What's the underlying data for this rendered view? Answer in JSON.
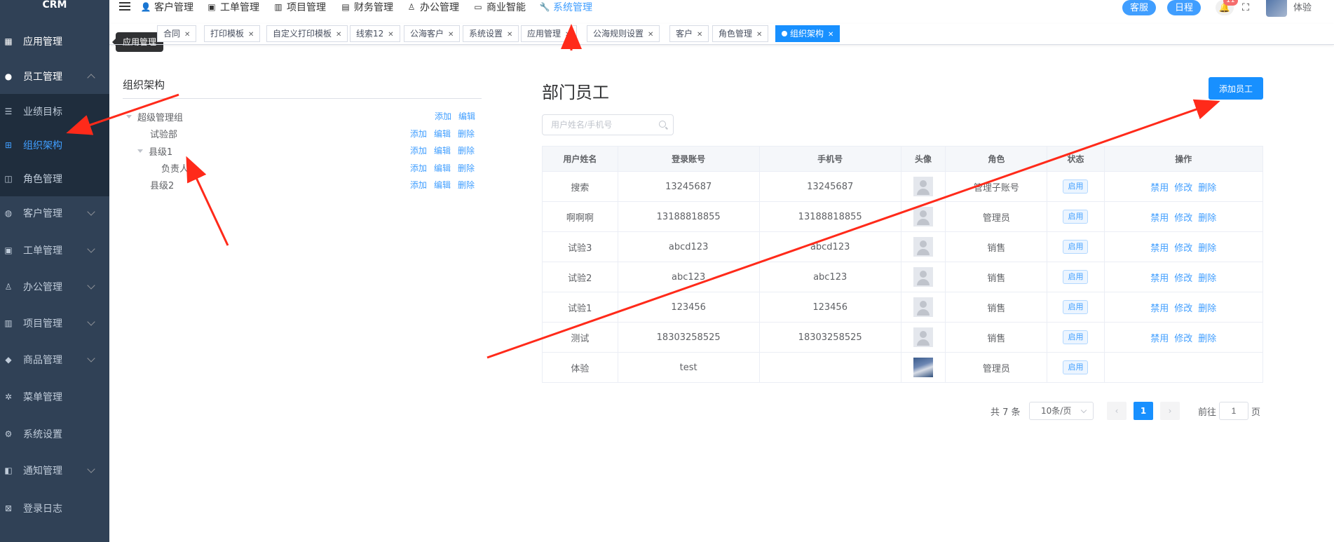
{
  "app": {
    "logo": "CRM"
  },
  "sidebar": {
    "items": [
      {
        "label": "应用管理",
        "icon": "grid-icon"
      },
      {
        "label": "员工管理",
        "icon": "user-icon"
      },
      {
        "label": "业绩目标",
        "icon": "list-icon"
      },
      {
        "label": "组织架构",
        "icon": "org-icon"
      },
      {
        "label": "角色管理",
        "icon": "role-icon"
      },
      {
        "label": "客户管理",
        "icon": "customer-icon"
      },
      {
        "label": "工单管理",
        "icon": "clipboard-icon"
      },
      {
        "label": "办公管理",
        "icon": "office-icon"
      },
      {
        "label": "项目管理",
        "icon": "project-icon"
      },
      {
        "label": "商品管理",
        "icon": "product-icon"
      },
      {
        "label": "菜单管理",
        "icon": "menu-gear-icon"
      },
      {
        "label": "系统设置",
        "icon": "settings-icon"
      },
      {
        "label": "通知管理",
        "icon": "notify-icon"
      },
      {
        "label": "登录日志",
        "icon": "log-icon"
      }
    ],
    "tooltip": "应用管理"
  },
  "topnav": {
    "items": [
      {
        "label": "客户管理"
      },
      {
        "label": "工单管理"
      },
      {
        "label": "项目管理"
      },
      {
        "label": "财务管理"
      },
      {
        "label": "办公管理"
      },
      {
        "label": "商业智能"
      },
      {
        "label": "系统管理"
      }
    ],
    "service_btn": "客服",
    "schedule_btn": "日程",
    "bell_badge": "11",
    "username": "体验"
  },
  "tabs": [
    {
      "label": "合同"
    },
    {
      "label": "打印模板"
    },
    {
      "label": "自定义打印模板"
    },
    {
      "label": "线索12"
    },
    {
      "label": "公海客户"
    },
    {
      "label": "系统设置"
    },
    {
      "label": "应用管理"
    },
    {
      "label": "公海规则设置"
    },
    {
      "label": "客户"
    },
    {
      "label": "角色管理"
    },
    {
      "label": "组织架构"
    }
  ],
  "org": {
    "title": "组织架构",
    "add": "添加",
    "edit": "编辑",
    "delete": "删除",
    "nodes": [
      {
        "label": "超级管理组"
      },
      {
        "label": "试验部"
      },
      {
        "label": "县级1"
      },
      {
        "label": "负责人"
      },
      {
        "label": "县级2"
      }
    ]
  },
  "employees": {
    "title": "部门员工",
    "add_button": "添加员工",
    "search_placeholder": "用户姓名/手机号",
    "columns": [
      "用户姓名",
      "登录账号",
      "手机号",
      "头像",
      "角色",
      "状态",
      "操作"
    ],
    "status_label": "启用",
    "ops": {
      "disable": "禁用",
      "modify": "修改",
      "delete": "删除"
    },
    "rows": [
      {
        "name": "搜索",
        "account": "13245687",
        "phone": "13245687",
        "role": "管理子账号"
      },
      {
        "name": "啊啊啊",
        "account": "13188818855",
        "phone": "13188818855",
        "role": "管理员"
      },
      {
        "name": "试验3",
        "account": "abcd123",
        "phone": "abcd123",
        "role": "销售"
      },
      {
        "name": "试验2",
        "account": "abc123",
        "phone": "abc123",
        "role": "销售"
      },
      {
        "name": "试验1",
        "account": "123456",
        "phone": "123456",
        "role": "销售"
      },
      {
        "name": "测试",
        "account": "18303258525",
        "phone": "18303258525",
        "role": "销售"
      },
      {
        "name": "体验",
        "account": "test",
        "phone": "",
        "role": "管理员"
      }
    ]
  },
  "pagination": {
    "total": "共 7 条",
    "page_size": "10条/页",
    "current": "1",
    "goto_label": "前往",
    "goto_value": "1",
    "unit": "页"
  },
  "colors": {
    "primary": "#1890ff",
    "sidebar": "#304156",
    "annotation": "#ff2a1a"
  }
}
